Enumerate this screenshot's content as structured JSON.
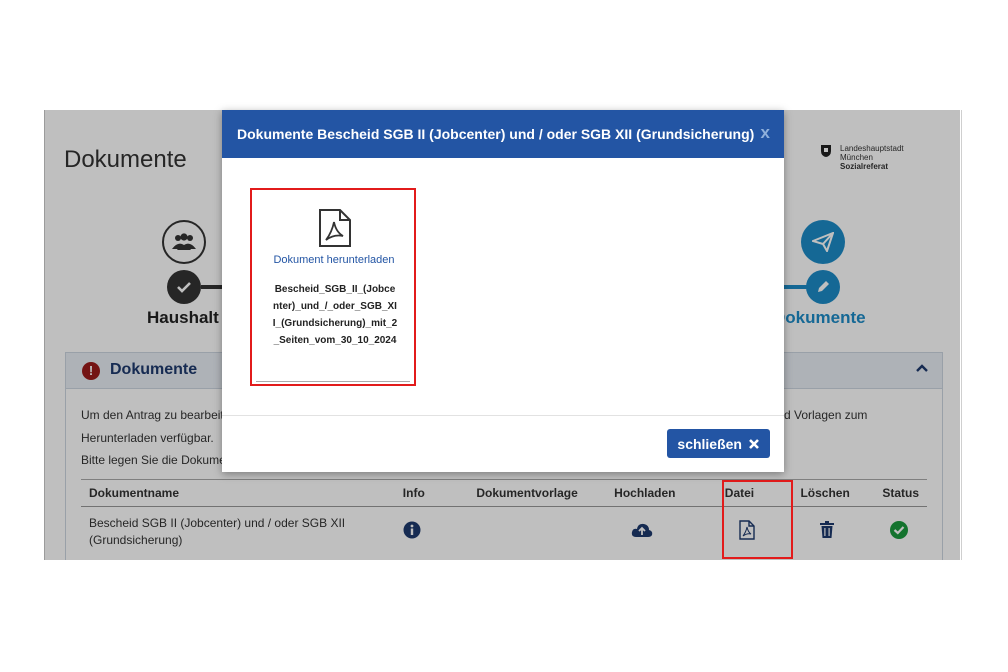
{
  "page": {
    "title": "Dokumente",
    "logo_lines": [
      "Landeshauptstadt",
      "München",
      "Sozialreferat"
    ]
  },
  "steps": {
    "left_label": "Haushalt",
    "right_label": "Dokumente"
  },
  "panel": {
    "title": "Dokumente",
    "text_line1_left": "Um den Antrag zu bearbeiten",
    "text_line1_right": "d Vorlagen zum",
    "text_line2": "Herunterladen verfügbar.",
    "text_line3": "Bitte legen Sie die Dokument"
  },
  "table": {
    "headers": [
      "Dokumentname",
      "Info",
      "Dokumentvorlage",
      "Hochladen",
      "Datei",
      "Löschen",
      "Status"
    ],
    "rows": [
      {
        "name": "Bescheid SGB II (Jobcenter) und / oder SGB XII (Grundsicherung)"
      }
    ]
  },
  "modal": {
    "title": "Dokumente Bescheid SGB II (Jobcenter) und / oder SGB XII (Grundsicherung)",
    "close_x": "x",
    "download_label": "Dokument herunterladen",
    "file_name": "Bescheid_SGB_II_(Jobcenter)_und_/_oder_SGB_XII_(Grundsicherung)_mit_2_Seiten_vom_30_10_2024",
    "close_button": "schließen"
  },
  "colors": {
    "primary": "#2355a4",
    "step_blue": "#1d8bc7",
    "highlight": "#e21b1b",
    "status_green": "#1b9a3e",
    "alert_red": "#9b1b1b"
  }
}
